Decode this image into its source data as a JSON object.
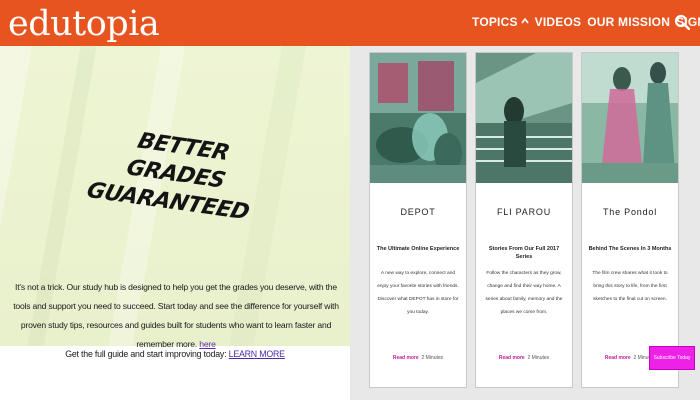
{
  "header": {
    "logo": "edutopia",
    "nav": [
      {
        "label": "TOPICS"
      },
      {
        "label": "VIDEOS"
      },
      {
        "label": "OUR MISSION"
      },
      {
        "label": "SIGN UP"
      }
    ],
    "colors": {
      "bar": "#e7541f",
      "text": "#ffffff"
    }
  },
  "promo": {
    "title": "BETTER GRADES GUARANTEED",
    "body_text": "It's not a trick. Our study hub is designed to help you get the grades you deserve, with the tools and support you need to succeed. Start today and see the difference for yourself with proven study tips, resources and guides built for students who want to learn faster and remember more.",
    "body_link": "here",
    "cta_prefix": "Get the full guide and start improving today:",
    "cta_link": "LEARN MORE"
  },
  "cards": [
    {
      "name": "DEPOT",
      "subtitle": "The Ultimate Online Experience",
      "description": "A new way to explore, connect and enjoy your favorite stories with friends. Discover what DEPOT has in store for you today.",
      "read_label": "Read more",
      "meta": "2 Minutes"
    },
    {
      "name": "FLI PAROU",
      "subtitle": "Stories From Our Full 2017 Series",
      "description": "Follow the characters as they grow, change and find their way home. A series about family, memory and the places we come from.",
      "read_label": "Read more",
      "meta": "2 Minutes"
    },
    {
      "name": "The Pondol",
      "subtitle": "Behind The Scenes In 3 Months",
      "description": "The film crew shares what it took to bring this story to life, from the first sketches to the final cut on screen.",
      "read_label": "Read more",
      "meta": "2 Minutes"
    }
  ],
  "fab": {
    "label": "Subscribe Today"
  }
}
